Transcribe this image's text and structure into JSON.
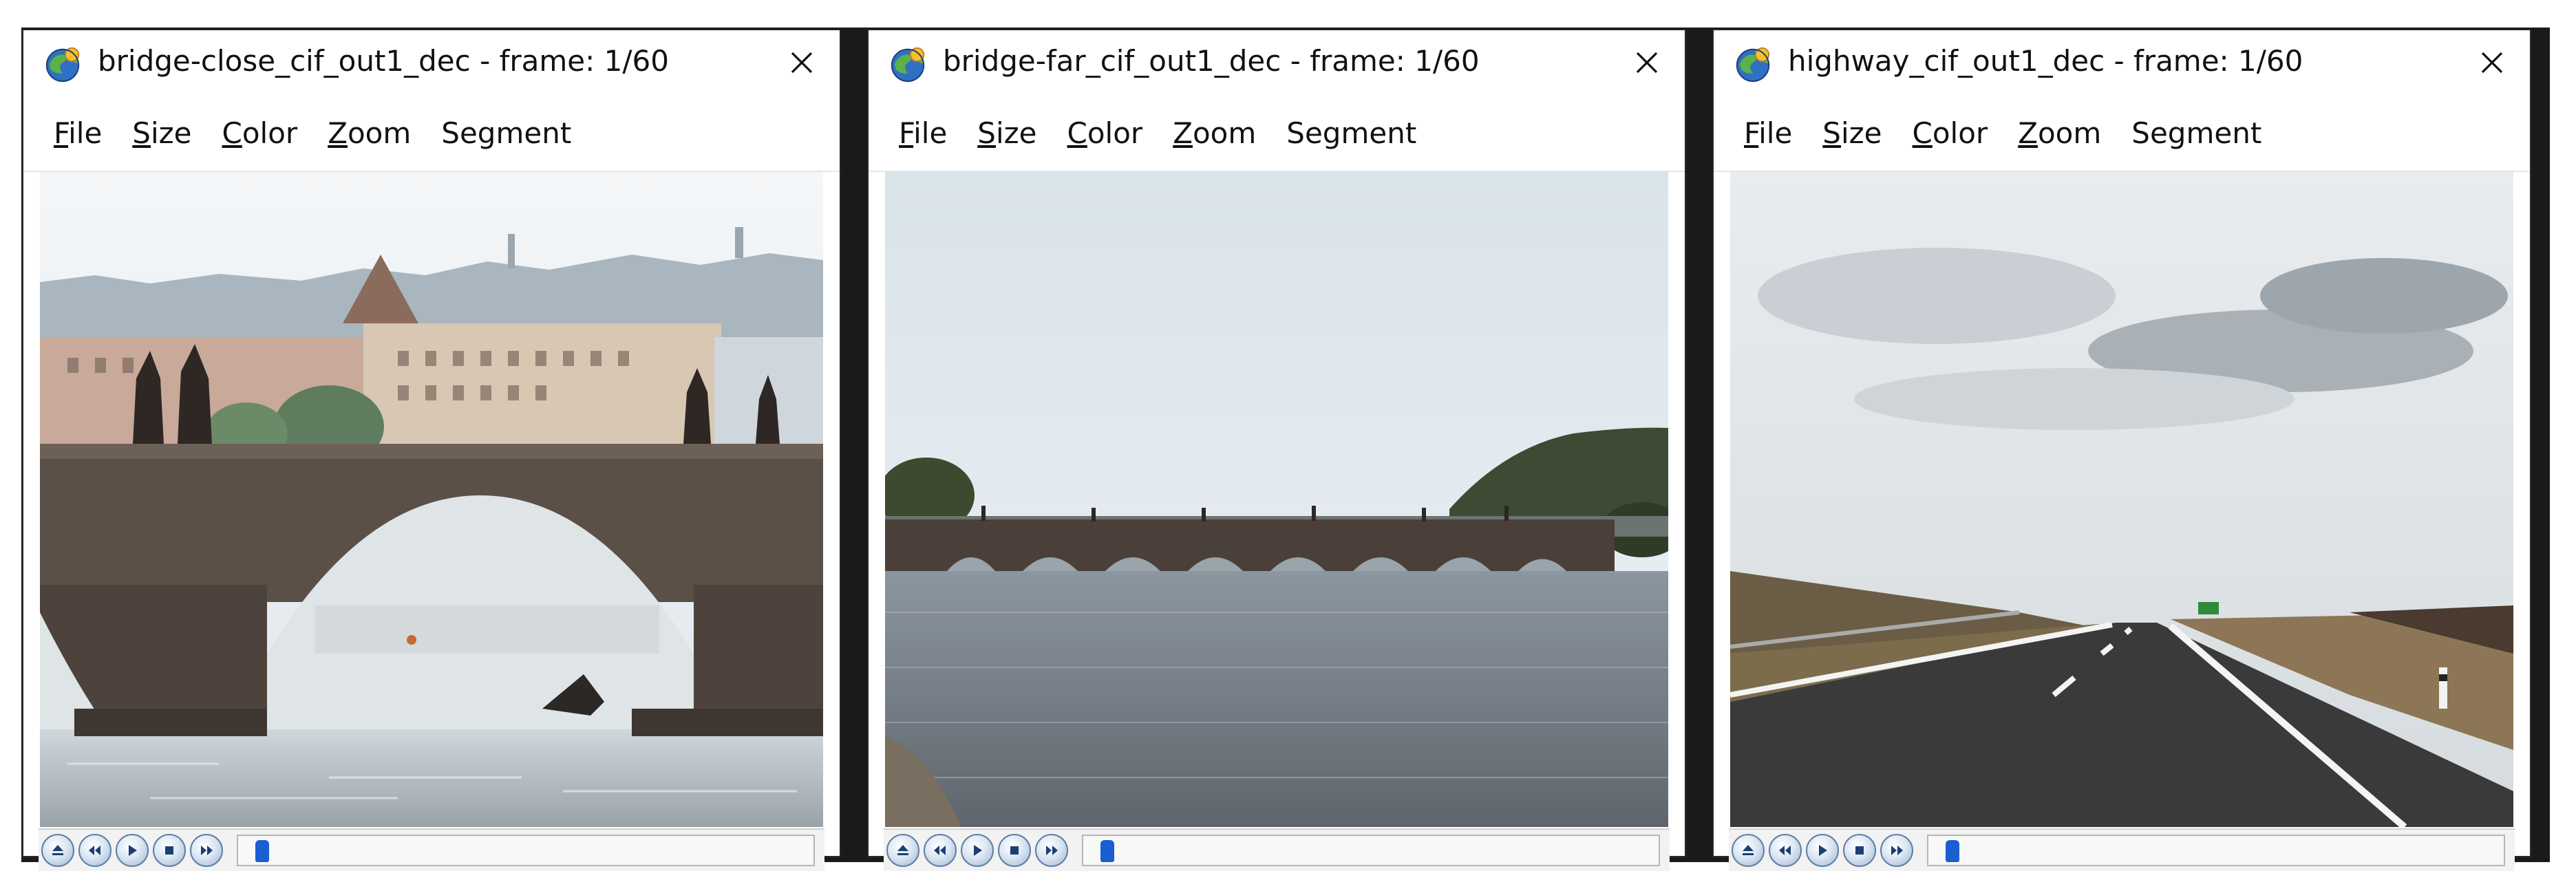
{
  "windows": [
    {
      "title": "bridge-close_cif_out1_dec - frame: 1/60",
      "menu": [
        "File",
        "Size",
        "Color",
        "Zoom",
        "Segment"
      ],
      "menu_mnemonic": [
        "F",
        "S",
        "C",
        "Z",
        ""
      ],
      "scene": "bridge-close",
      "progress": 0.017
    },
    {
      "title": "bridge-far_cif_out1_dec - frame: 1/60",
      "menu": [
        "File",
        "Size",
        "Color",
        "Zoom",
        "Segment"
      ],
      "menu_mnemonic": [
        "F",
        "S",
        "C",
        "Z",
        ""
      ],
      "scene": "bridge-far",
      "progress": 0.017
    },
    {
      "title": "highway_cif_out1_dec - frame: 1/60",
      "menu": [
        "File",
        "Size",
        "Color",
        "Zoom",
        "Segment"
      ],
      "menu_mnemonic": [
        "F",
        "S",
        "C",
        "Z",
        ""
      ],
      "scene": "highway",
      "progress": 0.017
    }
  ],
  "controls": [
    "eject-icon",
    "rewind-icon",
    "play-icon",
    "stop-icon",
    "fast-forward-icon"
  ],
  "colors": {
    "accent": "#1a5fd1",
    "frame": "#1c1a18",
    "button_ring": "#5e7fa6"
  }
}
